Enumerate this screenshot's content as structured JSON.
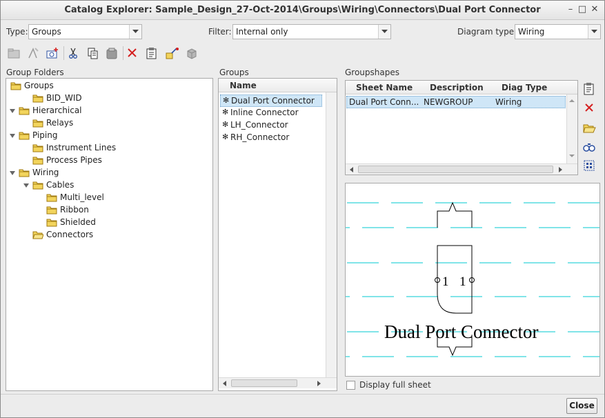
{
  "window": {
    "title": "Catalog Explorer: Sample_Design_27-Oct-2014\\Groups\\Wiring\\Connectors\\Dual Port Connector",
    "minimize": "–",
    "maximize": "□",
    "close": "✕"
  },
  "filters": {
    "type_label": "Type:",
    "type_value": "Groups",
    "filter_label": "Filter:",
    "filter_value": "Internal only",
    "diagram_label": "Diagram type:",
    "diagram_value": "Wiring"
  },
  "group_folders": {
    "title": "Group Folders",
    "items": [
      {
        "label": "Groups",
        "depth": 0,
        "expander": "none",
        "open": false
      },
      {
        "label": "BID_WID",
        "depth": 1,
        "expander": "none",
        "open": false
      },
      {
        "label": "Hierarchical",
        "depth": 0,
        "expander": "down",
        "open": false
      },
      {
        "label": "Relays",
        "depth": 1,
        "expander": "none",
        "open": false
      },
      {
        "label": "Piping",
        "depth": 0,
        "expander": "down",
        "open": false
      },
      {
        "label": "Instrument Lines",
        "depth": 1,
        "expander": "none",
        "open": false
      },
      {
        "label": "Process Pipes",
        "depth": 1,
        "expander": "none",
        "open": false
      },
      {
        "label": "Wiring",
        "depth": 0,
        "expander": "down",
        "open": false
      },
      {
        "label": "Cables",
        "depth": 1,
        "expander": "down",
        "open": false
      },
      {
        "label": "Multi_level",
        "depth": 2,
        "expander": "none",
        "open": false
      },
      {
        "label": "Ribbon",
        "depth": 2,
        "expander": "none",
        "open": false
      },
      {
        "label": "Shielded",
        "depth": 2,
        "expander": "none",
        "open": false
      },
      {
        "label": "Connectors",
        "depth": 1,
        "expander": "none",
        "open": true
      }
    ]
  },
  "groups": {
    "title": "Groups",
    "column": "Name",
    "items": [
      "Dual Port Connector",
      "Inline Connector",
      "LH_Connector",
      "RH_Connector"
    ],
    "selected_index": 0
  },
  "groupshapes": {
    "title": "Groupshapes",
    "columns": [
      "Sheet Name",
      "Description",
      "Diag Type"
    ],
    "rows": [
      {
        "sheet_name": "Dual Port Conn...",
        "description": "NEWGROUP",
        "diag_type": "Wiring"
      }
    ]
  },
  "preview": {
    "pin_left": "1",
    "pin_right": "1",
    "label": "Dual Port Connector",
    "guide_color": "#00c8d2"
  },
  "footer": {
    "display_full_sheet": "Display full sheet",
    "display_full_sheet_checked": false,
    "close": "Close"
  },
  "colors": {
    "selection": "#cfe6f7",
    "delete_red": "#d42020",
    "folder_yellow": "#f2d45c"
  }
}
